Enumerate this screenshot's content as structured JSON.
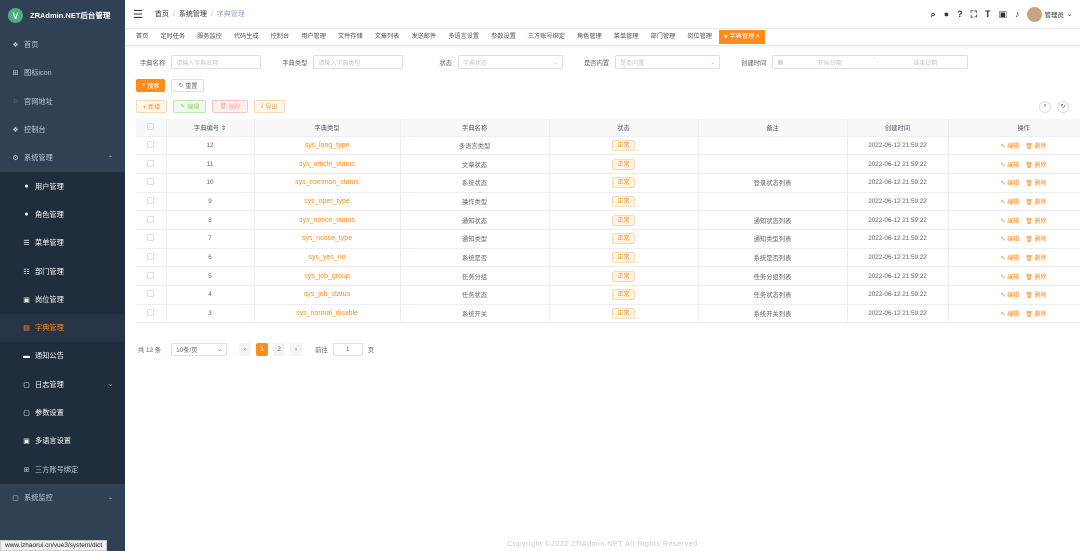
{
  "sidebar": {
    "logo_letter": "V",
    "title": "ZRAdmin.NET后台管理",
    "items": [
      {
        "icon": "dashboard-icon",
        "glyph": "❖",
        "label": "首页",
        "type": "top"
      },
      {
        "icon": "icon-grid-icon",
        "glyph": "⊞",
        "label": "图标icon",
        "type": "top"
      },
      {
        "icon": "external-link-icon",
        "glyph": "◌",
        "label": "官网地址",
        "type": "top"
      },
      {
        "icon": "console-icon",
        "glyph": "❖",
        "label": "控制台",
        "type": "top"
      },
      {
        "icon": "gear-icon",
        "glyph": "⚙",
        "label": "系统管理",
        "type": "top",
        "caret": "⌃"
      },
      {
        "icon": "user-icon",
        "glyph": "●",
        "label": "用户管理",
        "type": "sub"
      },
      {
        "icon": "role-icon",
        "glyph": "●",
        "label": "角色管理",
        "type": "sub"
      },
      {
        "icon": "menu-list-icon",
        "glyph": "☰",
        "label": "菜单管理",
        "type": "sub"
      },
      {
        "icon": "tree-icon",
        "glyph": "☷",
        "label": "部门管理",
        "type": "sub"
      },
      {
        "icon": "post-icon",
        "glyph": "▣",
        "label": "岗位管理",
        "type": "sub"
      },
      {
        "icon": "dictionary-icon",
        "glyph": "▤",
        "label": "字典管理",
        "type": "sub",
        "active": true
      },
      {
        "icon": "message-icon",
        "glyph": "▬",
        "label": "通知公告",
        "type": "sub"
      },
      {
        "icon": "log-icon",
        "glyph": "▢",
        "label": "日志管理",
        "type": "sub",
        "caret": "⌄"
      },
      {
        "icon": "edit-icon",
        "glyph": "▢",
        "label": "参数设置",
        "type": "sub"
      },
      {
        "icon": "language-icon",
        "glyph": "▣",
        "label": "多语言设置",
        "type": "sub"
      },
      {
        "icon": "third-party-icon",
        "glyph": "⊞",
        "label": "三方账号绑定",
        "type": "sub",
        "dim": true
      },
      {
        "icon": "monitor-icon",
        "glyph": "▢",
        "label": "系统监控",
        "type": "top",
        "caret": "⌄"
      }
    ]
  },
  "status_url": "www.izhaorui.cn/vue3/system/dict",
  "navbar": {
    "breadcrumb": [
      "首页",
      "系统管理",
      "字典管理"
    ],
    "user": "管理员"
  },
  "tags": [
    "首页",
    "定时任务",
    "服务监控",
    "代码生成",
    "控制台",
    "用户管理",
    "文件存储",
    "文章列表",
    "发送邮件",
    "多语言设置",
    "参数设置",
    "三方账号绑定",
    "角色管理",
    "菜单管理",
    "部门管理",
    "岗位管理",
    "● 字典管理 ×"
  ],
  "filters": {
    "dict_name_label": "字典名称",
    "dict_name_placeholder": "请输入字典名称",
    "dict_type_label": "字典类型",
    "dict_type_placeholder": "请输入字典类型",
    "status_label": "状态",
    "status_placeholder": "字典状态",
    "builtin_label": "是否内置",
    "builtin_placeholder": "是否内置",
    "time_label": "创建时间",
    "start_placeholder": "开始日期",
    "range_sep": "-",
    "end_placeholder": "结束日期",
    "search_label": "搜索",
    "reset_label": "重置"
  },
  "actions": {
    "add": "+ 新增",
    "edit": "编辑",
    "delete": "删除",
    "export": "导出"
  },
  "table": {
    "headers": [
      "",
      "字典编号",
      "字典类型",
      "字典名称",
      "状态",
      "备注",
      "创建时间",
      "操作"
    ],
    "sort_mark": "⇕",
    "edit_label": "编辑",
    "delete_label": "删除",
    "rows": [
      {
        "id": "12",
        "type": "sys_lang_type",
        "name": "多语言类型",
        "status": "正常",
        "remark": "",
        "time": "2022-06-12 21:59:22"
      },
      {
        "id": "11",
        "type": "sys_article_status",
        "name": "文章状态",
        "status": "正常",
        "remark": "",
        "time": "2022-06-12 21:59:22"
      },
      {
        "id": "10",
        "type": "sys_common_status",
        "name": "系统状态",
        "status": "正常",
        "remark": "登录状态列表",
        "time": "2022-06-12 21:59:22"
      },
      {
        "id": "9",
        "type": "sys_oper_type",
        "name": "操作类型",
        "status": "正常",
        "remark": "",
        "time": "2022-06-12 21:59:22"
      },
      {
        "id": "8",
        "type": "sys_notice_status",
        "name": "通知状态",
        "status": "正常",
        "remark": "通知状态列表",
        "time": "2022-06-12 21:59:22"
      },
      {
        "id": "7",
        "type": "sys_notice_type",
        "name": "通知类型",
        "status": "正常",
        "remark": "通知类型列表",
        "time": "2022-06-12 21:59:22"
      },
      {
        "id": "6",
        "type": "sys_yes_no",
        "name": "系统是否",
        "status": "正常",
        "remark": "系统是否列表",
        "time": "2022-06-12 21:59:22"
      },
      {
        "id": "5",
        "type": "sys_job_group",
        "name": "任务分组",
        "status": "正常",
        "remark": "任务分组列表",
        "time": "2022-06-12 21:59:22"
      },
      {
        "id": "4",
        "type": "sys_job_status",
        "name": "任务状态",
        "status": "正常",
        "remark": "任务状态列表",
        "time": "2022-06-12 21:59:22"
      },
      {
        "id": "3",
        "type": "sys_normal_disable",
        "name": "系统开关",
        "status": "正常",
        "remark": "系统开关列表",
        "time": "2022-06-12 21:59:22"
      }
    ]
  },
  "pagination": {
    "total": "共 12 条",
    "page_size": "10条/页",
    "pages": [
      "1",
      "2"
    ],
    "goto_label": "前往",
    "goto_value": "1",
    "page_suffix": "页"
  },
  "footer": "Copyright ©2022 ZRAdmin.NET All Rights Reserved",
  "colors": {
    "accent": "#ff8c1a",
    "sidebar": "#304156"
  }
}
